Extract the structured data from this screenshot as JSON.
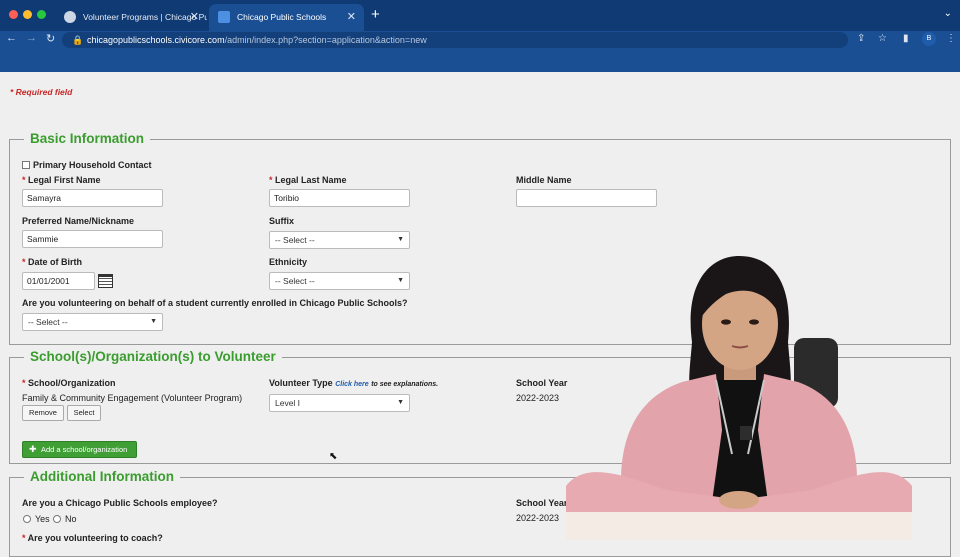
{
  "browser": {
    "tabs": [
      {
        "label": "Volunteer Programs | Chicago Pu"
      },
      {
        "label": "Chicago Public Schools"
      }
    ],
    "url_host": "chicagopublicschools.civicore.com",
    "url_path": "/admin/index.php?section=application&action=new",
    "profile_initial": "B"
  },
  "page": {
    "required_note": "* Required field"
  },
  "basic": {
    "legend": "Basic Information",
    "primary_contact": "Primary Household Contact",
    "first_name_label": "Legal First Name",
    "first_name_value": "Samayra",
    "last_name_label": "Legal Last Name",
    "last_name_value": "Toribio",
    "middle_name_label": "Middle Name",
    "middle_name_value": "",
    "nickname_label": "Preferred Name/Nickname",
    "nickname_value": "Sammie",
    "suffix_label": "Suffix",
    "suffix_value": "-- Select --",
    "dob_label": "Date of Birth",
    "dob_value": "01/01/2001",
    "ethnicity_label": "Ethnicity",
    "ethnicity_value": "-- Select --",
    "student_question": "Are you volunteering on behalf of a student currently enrolled in Chicago Public Schools?",
    "student_value": "-- Select --"
  },
  "schools": {
    "legend": "School(s)/Organization(s) to Volunteer",
    "school_label": "School/Organization",
    "school_value": "Family & Community Engagement (Volunteer Program)",
    "remove_label": "Remove",
    "select_label": "Select",
    "type_label": "Volunteer Type",
    "type_link": "Click here",
    "type_hint": "to see explanations.",
    "type_value": "Level I",
    "year_label": "School Year",
    "year_value": "2022-2023",
    "add_label": "Add a school/organization"
  },
  "additional": {
    "legend": "Additional Information",
    "employee_question": "Are you a Chicago Public Schools employee?",
    "yes_label": "Yes",
    "no_label": "No",
    "year_label": "School Year",
    "year_value": "2022-2023",
    "coach_question": "Are you volunteering to coach?"
  },
  "colors": {
    "chrome": "#0f3a73",
    "site_header": "#1b4f94",
    "legend_green": "#3a9d2e",
    "required_red": "#c62828",
    "button_green": "#3f9e34"
  }
}
